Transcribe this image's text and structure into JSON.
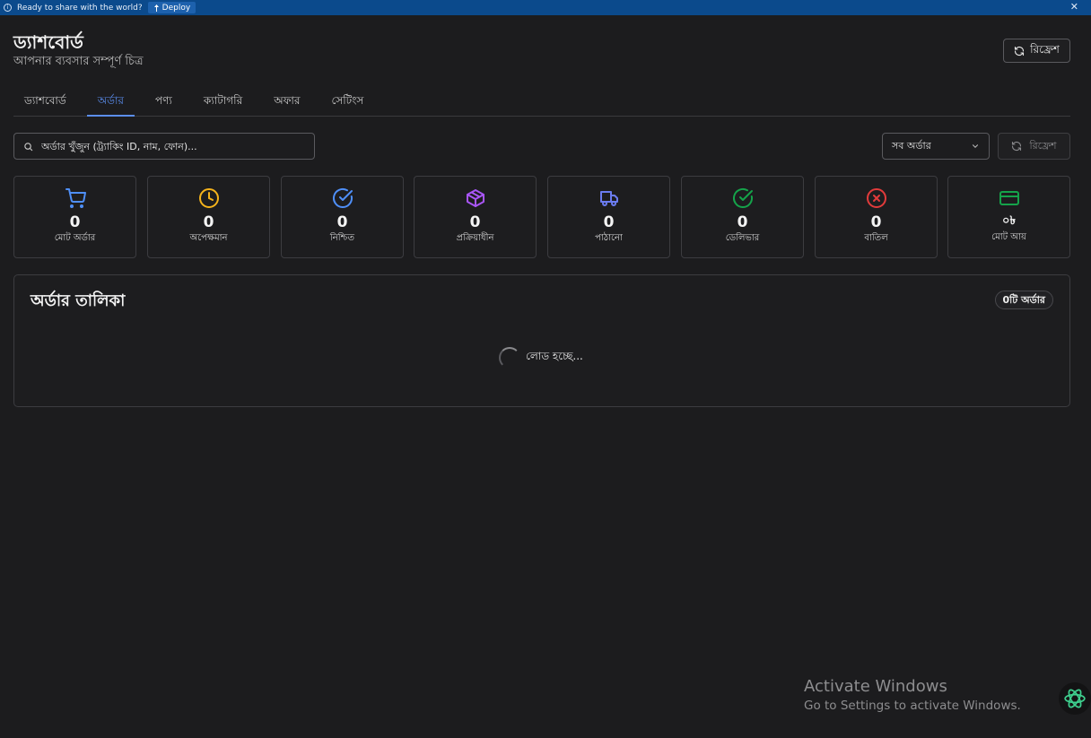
{
  "banner": {
    "message": "Ready to share with the world?",
    "deploy_label": "Deploy",
    "bg_color": "#0b4a8c"
  },
  "header": {
    "title": "ড্যাশবোর্ড",
    "subtitle": "আপনার ব্যবসার সম্পূর্ণ চিত্র",
    "refresh_label": "রিফ্রেশ"
  },
  "tabs": [
    {
      "label": "ড্যাশবোর্ড",
      "active": false
    },
    {
      "label": "অর্ডার",
      "active": true
    },
    {
      "label": "পণ্য",
      "active": false
    },
    {
      "label": "ক্যাটাগরি",
      "active": false
    },
    {
      "label": "অফার",
      "active": false
    },
    {
      "label": "সেটিংস",
      "active": false
    }
  ],
  "toolbar": {
    "search_placeholder": "অর্ডার খুঁজুন (ট্র্যাকিং ID, নাম, ফোন)...",
    "filter_value": "সব অর্ডার",
    "refresh_label": "রিফ্রেশ"
  },
  "stats": [
    {
      "icon": "cart-icon",
      "color": "#4f8ff7",
      "value": "0",
      "label": "মোট অর্ডার"
    },
    {
      "icon": "clock-icon",
      "color": "#f5b31b",
      "value": "0",
      "label": "অপেক্ষমান"
    },
    {
      "icon": "check-circle-icon",
      "color": "#4f8ff7",
      "value": "0",
      "label": "নিশ্চিত"
    },
    {
      "icon": "package-icon",
      "color": "#a855f7",
      "value": "0",
      "label": "প্রক্রিয়াধীন"
    },
    {
      "icon": "truck-icon",
      "color": "#6b7cf0",
      "value": "0",
      "label": "পাঠানো"
    },
    {
      "icon": "check-circle-green-icon",
      "color": "#15a34a",
      "value": "0",
      "label": "ডেলিভার"
    },
    {
      "icon": "x-circle-icon",
      "color": "#e23b3b",
      "value": "0",
      "label": "বাতিল"
    },
    {
      "icon": "credit-card-icon",
      "color": "#15a34a",
      "value": "০৳",
      "label": "মোট আয়"
    }
  ],
  "orders": {
    "title": "অর্ডার তালিকা",
    "count_badge": "0টি অর্ডার",
    "loading_text": "লোড হচ্ছে..."
  },
  "watermark": {
    "line1": "Activate Windows",
    "line2": "Go to Settings to activate Windows."
  }
}
